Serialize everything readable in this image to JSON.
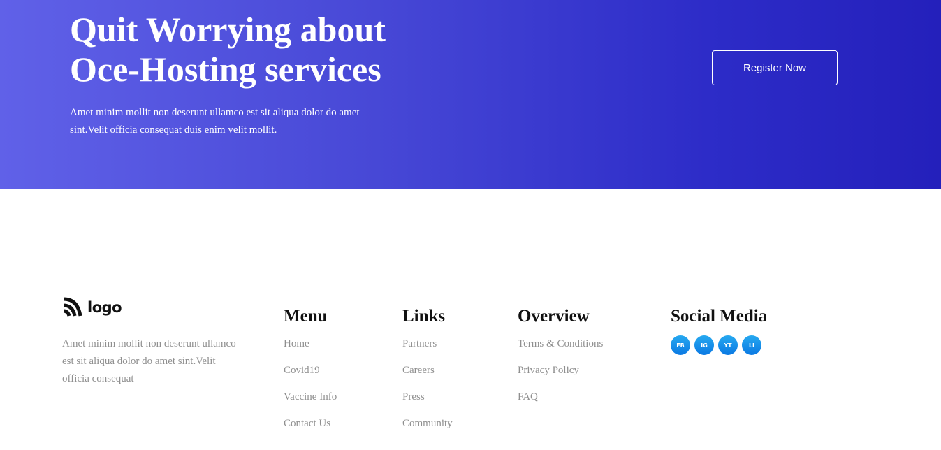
{
  "hero": {
    "title_line1": "Quit Worrying about",
    "title_line2": "Oce-Hosting services",
    "description": "Amet minim mollit non deserunt ullamco est sit aliqua dolor do amet sint.Velit officia consequat duis enim velit mollit.",
    "register_label": "Register Now"
  },
  "footer": {
    "logo_text": "logo",
    "description": "Amet minim mollit non deserunt ullamco est sit aliqua dolor do amet sint.Velit officia consequat",
    "menu": {
      "heading": "Menu",
      "items": [
        "Home",
        "Covid19",
        "Vaccine Info",
        "Contact Us"
      ]
    },
    "links": {
      "heading": "Links",
      "items": [
        "Partners",
        "Careers",
        "Press",
        "Community"
      ]
    },
    "overview": {
      "heading": "Overview",
      "items": [
        "Terms & Conditions",
        "Privacy Policy",
        "FAQ"
      ]
    },
    "social": {
      "heading": "Social Media",
      "items": [
        "FB",
        "IG",
        "YT",
        "LI"
      ]
    }
  },
  "colors": {
    "hero_gradient_start": "#6061e8",
    "hero_gradient_end": "#2420bb",
    "social_button": "#1490ea",
    "muted_text": "#8f8f8f"
  }
}
